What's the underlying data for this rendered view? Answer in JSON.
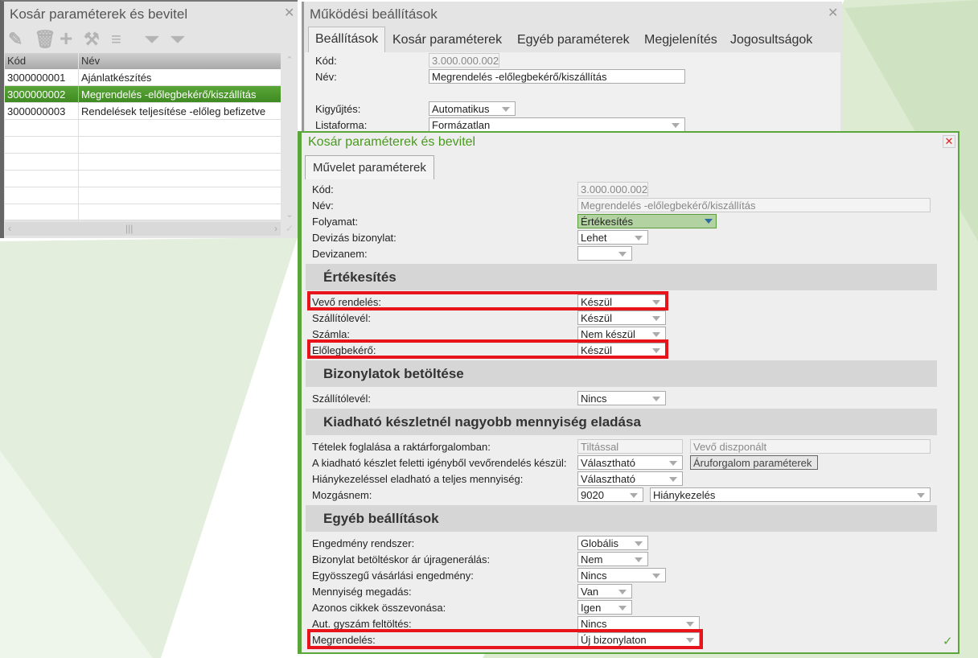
{
  "left_panel": {
    "title": "Kosár paraméterek és bevitel",
    "toolbar": [
      "pencil-icon",
      "trash-icon",
      "plus-icon",
      "tools-icon",
      "menu-icon",
      "filter-icon",
      "filter-clear-icon"
    ],
    "columns": [
      "Kód",
      "Név"
    ],
    "rows": [
      {
        "code": "3000000001",
        "name": "Ajánlatkészítés"
      },
      {
        "code": "3000000002",
        "name": "Megrendelés -előlegbekérő/kiszállítás"
      },
      {
        "code": "3000000003",
        "name": "Rendelések teljesítése -előleg befizetve"
      }
    ],
    "selected_index": 1
  },
  "middle_panel": {
    "title": "Működési beállítások",
    "tabs": [
      "Beállítások",
      "Kosár paraméterek",
      "Egyéb paraméterek",
      "Megjelenítés",
      "Jogosultságok"
    ],
    "fields": {
      "kod_label": "Kód:",
      "kod": "3.000.000.002",
      "nev_label": "Név:",
      "nev": "Megrendelés -előlegbekérő/kiszállítás",
      "kigyujtes_label": "Kigyűjtés:",
      "kigyujtes": "Automatikus",
      "listaforma_label": "Listaforma:",
      "listaforma": "Formázatlan"
    }
  },
  "dialog": {
    "title": "Kosár paraméterek és bevitel",
    "tab": "Művelet paraméterek",
    "accent": "#4a9a1e",
    "top": {
      "kod_label": "Kód:",
      "kod": "3.000.000.002",
      "nev_label": "Név:",
      "nev": "Megrendelés -előlegbekérő/kiszállítás",
      "folyamat_label": "Folyamat:",
      "folyamat": "Értékesítés",
      "deviza_label": "Devizás bizonylat:",
      "deviza": "Lehet",
      "devizanem_label": "Devizanem:",
      "devizanem": ""
    },
    "sections": [
      {
        "title": "Értékesítés",
        "rows": [
          {
            "label": "Vevő rendelés:",
            "value": "Készül"
          },
          {
            "label": "Szállítólevél:",
            "value": "Készül"
          },
          {
            "label": "Számla:",
            "value": "Nem készül"
          },
          {
            "label": "Előlegbekérő:",
            "value": "Készül"
          }
        ]
      },
      {
        "title": "Bizonylatok betöltése",
        "rows": [
          {
            "label": "Szállítólevél:",
            "value": "Nincs"
          }
        ]
      },
      {
        "title": "Kiadható készletnél nagyobb mennyiség eladása",
        "rows": [
          {
            "label": "Tételek foglalása a raktárforgalomban:",
            "value": "Tiltással",
            "value2": "Vevő diszponált"
          },
          {
            "label": "A kiadható készlet feletti igényből vevőrendelés készül:",
            "value": "Választható",
            "button": "Áruforgalom paraméterek"
          },
          {
            "label": "Hiánykezeléssel eladható a teljes mennyiség:",
            "value": "Választható"
          },
          {
            "label": "Mozgásnem:",
            "value": "9020",
            "value2": "Hiánykezelés"
          }
        ]
      },
      {
        "title": "Egyéb beállítások",
        "rows": [
          {
            "label": "Engedmény rendszer:",
            "value": "Globális"
          },
          {
            "label": "Bizonylat betöltéskor ár újragenerálás:",
            "value": "Nem"
          },
          {
            "label": "Egyösszegű vásárlási engedmény:",
            "value": "Nincs"
          },
          {
            "label": "Mennyiség megadás:",
            "value": "Van"
          },
          {
            "label": "Azonos cikkek összevonása:",
            "value": "Igen"
          },
          {
            "label": "Aut. gyszám feltöltés:",
            "value": "Nincs"
          },
          {
            "label": "Megrendelés:",
            "value": "Új bizonylaton"
          }
        ]
      }
    ],
    "highlight_color": "#e8141b"
  }
}
